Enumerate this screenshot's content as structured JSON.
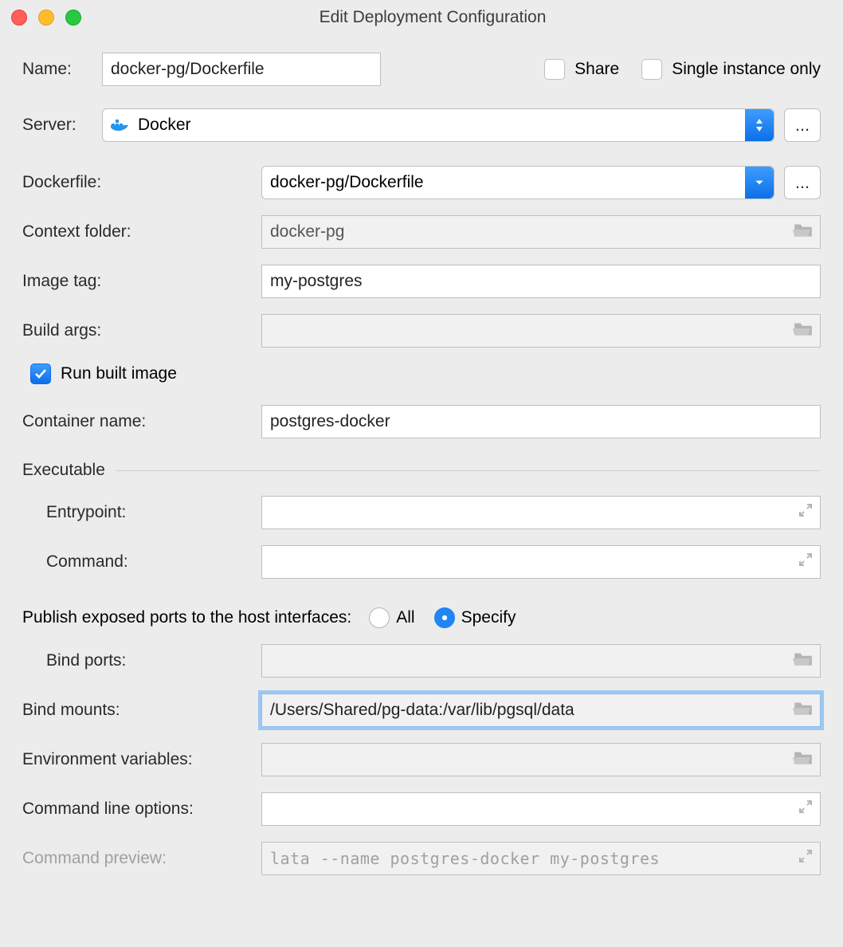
{
  "window": {
    "title": "Edit Deployment Configuration"
  },
  "labels": {
    "name": "Name:",
    "share": "Share",
    "single": "Single instance only",
    "server": "Server:",
    "dockerfile": "Dockerfile:",
    "context": "Context folder:",
    "imagetag": "Image tag:",
    "buildargs": "Build args:",
    "runbuilt": "Run built image",
    "container": "Container name:",
    "executable": "Executable",
    "entrypoint": "Entrypoint:",
    "command": "Command:",
    "portslabel": "Publish exposed ports to the host interfaces:",
    "all": "All",
    "specify": "Specify",
    "bindports": "Bind ports:",
    "bindmounts": "Bind mounts:",
    "env": "Environment variables:",
    "cliopts": "Command line options:",
    "preview": "Command preview:"
  },
  "fields": {
    "name": "docker-pg/Dockerfile",
    "server": "Docker",
    "dockerfile": "docker-pg/Dockerfile",
    "context": "docker-pg",
    "imagetag": "my-postgres",
    "buildargs": "",
    "runbuilt_checked": true,
    "container": "postgres-docker",
    "entrypoint": "",
    "command": "",
    "ports_mode": "specify",
    "bindports": "",
    "bindmounts": "/Users/Shared/pg-data:/var/lib/pgsql/data",
    "env": "",
    "cliopts": "",
    "preview": "lata --name postgres-docker my-postgres"
  },
  "ellipsis": "..."
}
